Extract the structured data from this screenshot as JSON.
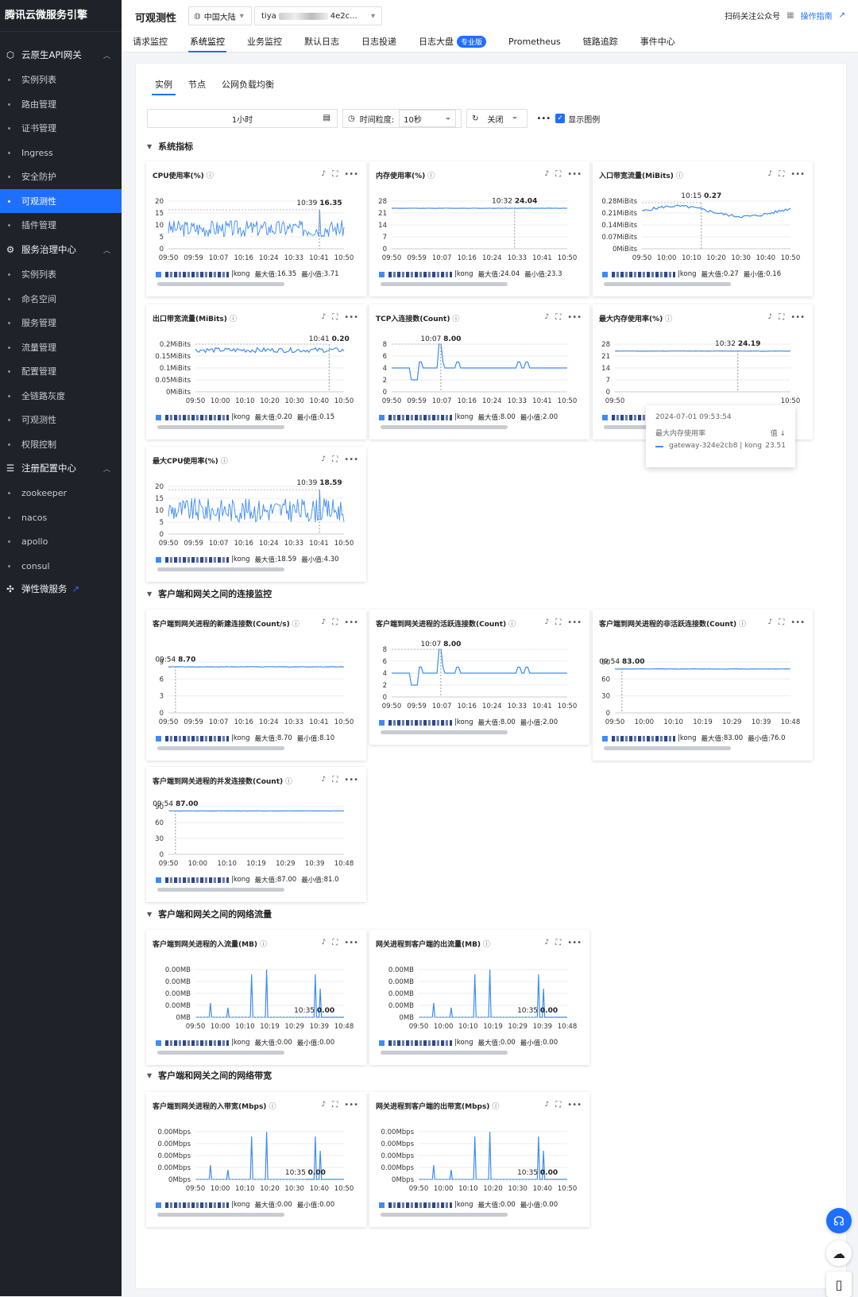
{
  "sidebar": {
    "brand": "腾讯云微服务引擎",
    "groups": [
      {
        "label": "云原生API网关",
        "icon": "gateway-icon"
      },
      {
        "label": "服务治理中心",
        "icon": "governance-icon"
      },
      {
        "label": "注册配置中心",
        "icon": "registry-icon"
      },
      {
        "label": "弹性微服务",
        "icon": "elastic-icon"
      }
    ],
    "items": [
      "实例列表",
      "路由管理",
      "证书管理",
      "Ingress",
      "安全防护",
      "可观测性",
      "插件管理",
      "实例列表",
      "命名空间",
      "服务管理",
      "流量管理",
      "配置管理",
      "全链路灰度",
      "可观测性",
      "权限控制",
      "zookeeper",
      "nacos",
      "apollo",
      "consul"
    ],
    "active_item": "可观测性"
  },
  "topbar": {
    "title": "可观测性",
    "region": "中国大陆",
    "instance_prefix": "tiya",
    "instance_suffix": "4e2c...",
    "follow": "扫码关注公众号",
    "guide": "操作指南"
  },
  "tabs": [
    {
      "label": "请求监控"
    },
    {
      "label": "系统监控"
    },
    {
      "label": "业务监控"
    },
    {
      "label": "默认日志"
    },
    {
      "label": "日志投递"
    },
    {
      "label": "日志大盘",
      "badge": "专业版"
    },
    {
      "label": "Prometheus"
    },
    {
      "label": "链路追踪"
    },
    {
      "label": "事件中心"
    }
  ],
  "active_tab": "系统监控",
  "subtabs": [
    "实例",
    "节点",
    "公网负载均衡"
  ],
  "toolbar": {
    "range": "1小时",
    "granularity_label": "时间粒度:",
    "granularity": "10秒",
    "refresh": "关闭",
    "show_legend": "显示图例"
  },
  "sections": [
    "系统指标",
    "客户端和网关之间的连接监控",
    "客户端和网关之间的网络流量",
    "客户端和网关之间的网络带宽"
  ],
  "tooltip": {
    "time": "2024-07-01 09:53:54",
    "metric": "最大内存使用率",
    "value_header": "值 ↓",
    "series": "gateway-324e2cb8 | kong",
    "value": "23.51"
  },
  "chart_data": [
    {
      "id": "cpu",
      "title": "CPU使用率(%)",
      "type": "line",
      "yticks": [
        "20",
        "15",
        "10",
        "5",
        "0"
      ],
      "ylim": [
        0,
        20
      ],
      "xticks": [
        "09:50",
        "09:59",
        "10:07",
        "10:16",
        "10:24",
        "10:33",
        "10:41",
        "10:50"
      ],
      "marker": {
        "time": "10:39",
        "value": "16.35"
      },
      "pattern": "noisy",
      "base": 8.5,
      "amp": 3.5,
      "spike": 16.35,
      "legend": {
        "series": "kong",
        "max": "16.35",
        "min": "3.71"
      }
    },
    {
      "id": "mem",
      "title": "内存使用率(%)",
      "type": "line",
      "yticks": [
        "28",
        "21",
        "14",
        "7",
        "0"
      ],
      "ylim": [
        0,
        28
      ],
      "xticks": [
        "09:50",
        "09:59",
        "10:07",
        "10:16",
        "10:24",
        "10:33",
        "10:41",
        "10:50"
      ],
      "marker": {
        "time": "10:32",
        "value": "24.04"
      },
      "pattern": "flat",
      "base": 23.8,
      "amp": 0.1,
      "legend": {
        "series": "kong",
        "max": "24.04",
        "min": "23.3"
      }
    },
    {
      "id": "in_bw",
      "title": "入口带宽流量(MiBits)",
      "type": "line",
      "yticks": [
        "0.28MiBits",
        "0.21MiBits",
        "0.14MiBits",
        "0.07MiBits",
        "0MiBits"
      ],
      "ylim": [
        0,
        0.28
      ],
      "xticks": [
        "09:50",
        "10:00",
        "10:10",
        "10:20",
        "10:30",
        "10:40",
        "10:50"
      ],
      "marker": {
        "time": "10:15",
        "value": "0.27"
      },
      "pattern": "wave",
      "base": 0.22,
      "amp": 0.03,
      "legend": {
        "series": "kong",
        "max": "0.27",
        "min": "0.16"
      }
    },
    {
      "id": "out_bw",
      "title": "出口带宽流量(MiBits)",
      "type": "line",
      "yticks": [
        "0.2MiBits",
        "0.15MiBits",
        "0.1MiBits",
        "0.05MiBits",
        "0MiBits"
      ],
      "ylim": [
        0,
        0.2
      ],
      "xticks": [
        "09:50",
        "10:00",
        "10:10",
        "10:20",
        "10:30",
        "10:40",
        "10:50"
      ],
      "marker": {
        "time": "10:41",
        "value": "0.20"
      },
      "pattern": "flatnoisy",
      "base": 0.175,
      "amp": 0.01,
      "legend": {
        "series": "kong",
        "max": "0.20",
        "min": "0.15"
      }
    },
    {
      "id": "tcp",
      "title": "TCP入连接数(Count)",
      "type": "line",
      "yticks": [
        "8",
        "6",
        "4",
        "2",
        "0"
      ],
      "ylim": [
        0,
        8
      ],
      "xticks": [
        "09:50",
        "09:59",
        "10:07",
        "10:16",
        "10:24",
        "10:33",
        "10:41",
        "10:50"
      ],
      "marker": {
        "time": "10:07",
        "value": "8.00"
      },
      "pattern": "steps",
      "base": 4,
      "legend": {
        "series": "kong",
        "max": "8.00",
        "min": "2.00"
      }
    },
    {
      "id": "maxmem",
      "title": "最大内存使用率(%)",
      "type": "line",
      "yticks": [
        "28",
        "21",
        "14",
        "7",
        "0"
      ],
      "ylim": [
        0,
        28
      ],
      "xticks": [
        "09:50",
        "10:50"
      ],
      "marker": {
        "time": "10:32",
        "value": "24.19"
      },
      "pattern": "flat",
      "base": 23.9,
      "amp": 0.1,
      "legend": {
        "series": "gate",
        "max": "",
        "min": "23.4"
      }
    },
    {
      "id": "maxcpu",
      "title": "最大CPU使用率(%)",
      "type": "line",
      "yticks": [
        "20",
        "15",
        "10",
        "5",
        "0"
      ],
      "ylim": [
        0,
        20
      ],
      "xticks": [
        "09:50",
        "09:59",
        "10:07",
        "10:16",
        "10:24",
        "10:33",
        "10:41",
        "10:50"
      ],
      "marker": {
        "time": "10:39",
        "value": "18.59"
      },
      "pattern": "noisy",
      "base": 10,
      "amp": 5,
      "spike": 18.59,
      "legend": {
        "series": "kong",
        "max": "18.59",
        "min": "4.30"
      }
    },
    {
      "id": "newconn",
      "title": "客户端到网关进程的新建连接数(Count/s)",
      "type": "line",
      "yticks": [
        "9",
        "6",
        "3",
        "0"
      ],
      "ylim": [
        0,
        9.5
      ],
      "xticks": [
        "09:50",
        "09:59",
        "10:07",
        "10:16",
        "10:24",
        "10:33",
        "10:41",
        "10:50"
      ],
      "marker": {
        "time": "09:54",
        "value": "8.70"
      },
      "pattern": "flat",
      "base": 8.6,
      "amp": 0.05,
      "legend": {
        "series": "kong",
        "max": "8.70",
        "min": "8.10"
      }
    },
    {
      "id": "active",
      "title": "客户端到网关进程的活跃连接数(Count)",
      "type": "line",
      "yticks": [
        "8",
        "6",
        "4",
        "2",
        "0"
      ],
      "ylim": [
        0,
        8
      ],
      "xticks": [
        "09:50",
        "09:59",
        "10:07",
        "10:16",
        "10:24",
        "10:33",
        "10:41",
        "10:50"
      ],
      "marker": {
        "time": "10:07",
        "value": "8.00"
      },
      "pattern": "steps",
      "base": 4,
      "legend": {
        "series": "kong",
        "max": "8.00",
        "min": "2.00"
      }
    },
    {
      "id": "inactive",
      "title": "客户端到网关进程的非活跃连接数(Count)",
      "type": "line",
      "yticks": [
        "90",
        "60",
        "30",
        "0"
      ],
      "ylim": [
        0,
        95
      ],
      "xticks": [
        "09:50",
        "10:00",
        "10:10",
        "10:19",
        "10:29",
        "10:39",
        "10:48"
      ],
      "marker": {
        "time": "09:54",
        "value": "83.00"
      },
      "pattern": "flat",
      "base": 82,
      "amp": 0.4,
      "legend": {
        "series": "kong",
        "max": "83.00",
        "min": "76.0"
      }
    },
    {
      "id": "concurrent",
      "title": "客户端到网关进程的并发连接数(Count)",
      "type": "line",
      "yticks": [
        "90",
        "60",
        "30",
        "0"
      ],
      "ylim": [
        0,
        95
      ],
      "xticks": [
        "09:50",
        "10:00",
        "10:10",
        "10:19",
        "10:29",
        "10:39",
        "10:48"
      ],
      "marker": {
        "time": "09:54",
        "value": "87.00"
      },
      "pattern": "flat",
      "base": 86.5,
      "amp": 0.3,
      "legend": {
        "series": "kong",
        "max": "87.00",
        "min": "81.0"
      }
    },
    {
      "id": "inflow",
      "title": "客户端到网关进程的入流量(MB)",
      "type": "line",
      "yticks": [
        "0.00MB",
        "0.00MB",
        "0.00MB",
        "0.00MB",
        "0MB"
      ],
      "ylim": [
        0,
        1
      ],
      "xticks": [
        "09:50",
        "10:00",
        "10:10",
        "10:19",
        "10:29",
        "10:39",
        "10:48"
      ],
      "marker": {
        "time": "10:35",
        "value": "0.00"
      },
      "pattern": "spikes",
      "legend": {
        "series": "kong",
        "max": "0.00",
        "min": "0.00"
      }
    },
    {
      "id": "outflow",
      "title": "网关进程到客户端的出流量(MB)",
      "type": "line",
      "yticks": [
        "0.00MB",
        "0.00MB",
        "0.00MB",
        "0.00MB",
        "0MB"
      ],
      "ylim": [
        0,
        1
      ],
      "xticks": [
        "09:50",
        "10:00",
        "10:10",
        "10:19",
        "10:29",
        "10:39",
        "10:48"
      ],
      "marker": {
        "time": "10:35",
        "value": "0.00"
      },
      "pattern": "spikes",
      "legend": {
        "series": "kong",
        "max": "0.00",
        "min": "0.00"
      }
    },
    {
      "id": "inbw2",
      "title": "客户端到网关进程的入带宽(Mbps)",
      "type": "line",
      "yticks": [
        "0.00Mbps",
        "0.00Mbps",
        "0.00Mbps",
        "0.00Mbps",
        "0Mbps"
      ],
      "ylim": [
        0,
        1
      ],
      "xticks": [
        "09:50",
        "10:00",
        "10:10",
        "10:20",
        "10:30",
        "10:40",
        "10:50"
      ],
      "marker": {
        "time": "10:35",
        "value": "0.00"
      },
      "pattern": "spikes",
      "legend": {
        "series": "kong",
        "max": "0.00",
        "min": "0.00"
      }
    },
    {
      "id": "outbw2",
      "title": "网关进程到客户端的出带宽(Mbps)",
      "type": "line",
      "yticks": [
        "0.00Mbps",
        "0.00Mbps",
        "0.00Mbps",
        "0.00Mbps",
        "0Mbps"
      ],
      "ylim": [
        0,
        1
      ],
      "xticks": [
        "09:50",
        "10:00",
        "10:10",
        "10:20",
        "10:30",
        "10:40",
        "10:50"
      ],
      "marker": {
        "time": "10:35",
        "value": "0.00"
      },
      "pattern": "spikes",
      "legend": {
        "series": "kong",
        "max": "0.00",
        "min": "0.00"
      }
    }
  ],
  "legend_labels": {
    "max": "最大值:",
    "min": "最小值:"
  },
  "colors": {
    "accent": "#1f6fff",
    "line": "#3d8cf5",
    "sidebar": "#1f2329"
  }
}
